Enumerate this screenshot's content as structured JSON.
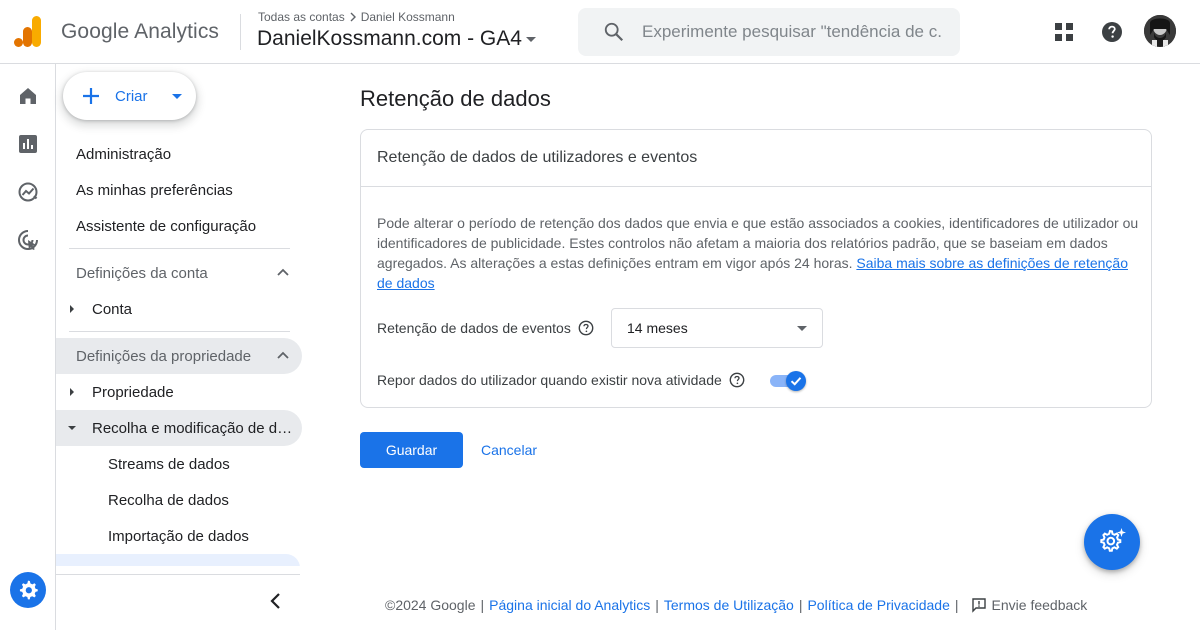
{
  "header": {
    "brand": "Google Analytics",
    "breadcrumb_root": "Todas as contas",
    "breadcrumb_account": "Daniel Kossmann",
    "property_name": "DanielKossmann.com - GA4",
    "search_placeholder": "Experimente pesquisar \"tendência de c...",
    "icons": [
      "apps-grid-icon",
      "help-icon",
      "avatar"
    ]
  },
  "rail": {
    "icons": [
      "home-icon",
      "reports-icon",
      "explore-icon",
      "advertising-icon",
      "admin-gear-icon"
    ]
  },
  "nav": {
    "create_label": "Criar",
    "items": [
      {
        "label": "Administração"
      },
      {
        "label": "As minhas preferências"
      },
      {
        "label": "Assistente de configuração"
      }
    ],
    "account_section": "Definições da conta",
    "account_items": [
      {
        "label": "Conta"
      }
    ],
    "property_section": "Definições da propriedade",
    "property_items": [
      {
        "label": "Propriedade"
      },
      {
        "label": "Recolha e modificação de dados"
      }
    ],
    "collection_children": [
      {
        "label": "Streams de dados"
      },
      {
        "label": "Recolha de dados"
      },
      {
        "label": "Importação de dados"
      }
    ]
  },
  "main": {
    "title": "Retenção de dados",
    "card_title": "Retenção de dados de utilizadores e eventos",
    "description": "Pode alterar o período de retenção dos dados que envia e que estão associados a cookies, identificadores de utilizador ou identificadores de publicidade. Estes controlos não afetam a maioria dos relatórios padrão, que se baseiam em dados agregados. As alterações a estas definições entram em vigor após 24 horas.",
    "learn_more_link": "Saiba mais sobre as definições de retenção de dados",
    "event_retention_label": "Retenção de dados de eventos",
    "event_retention_value": "14 meses",
    "reset_label": "Repor dados do utilizador quando existir nova atividade",
    "reset_enabled": true,
    "save_label": "Guardar",
    "cancel_label": "Cancelar"
  },
  "footer": {
    "copyright": "©2024 Google",
    "links": [
      "Página inicial do Analytics",
      "Termos de Utilização",
      "Política de Privacidade"
    ],
    "feedback": "Envie feedback"
  },
  "colors": {
    "accent": "#1a73e8",
    "ga_orange": "#f9ab00",
    "ga_dark_orange": "#e37400"
  }
}
